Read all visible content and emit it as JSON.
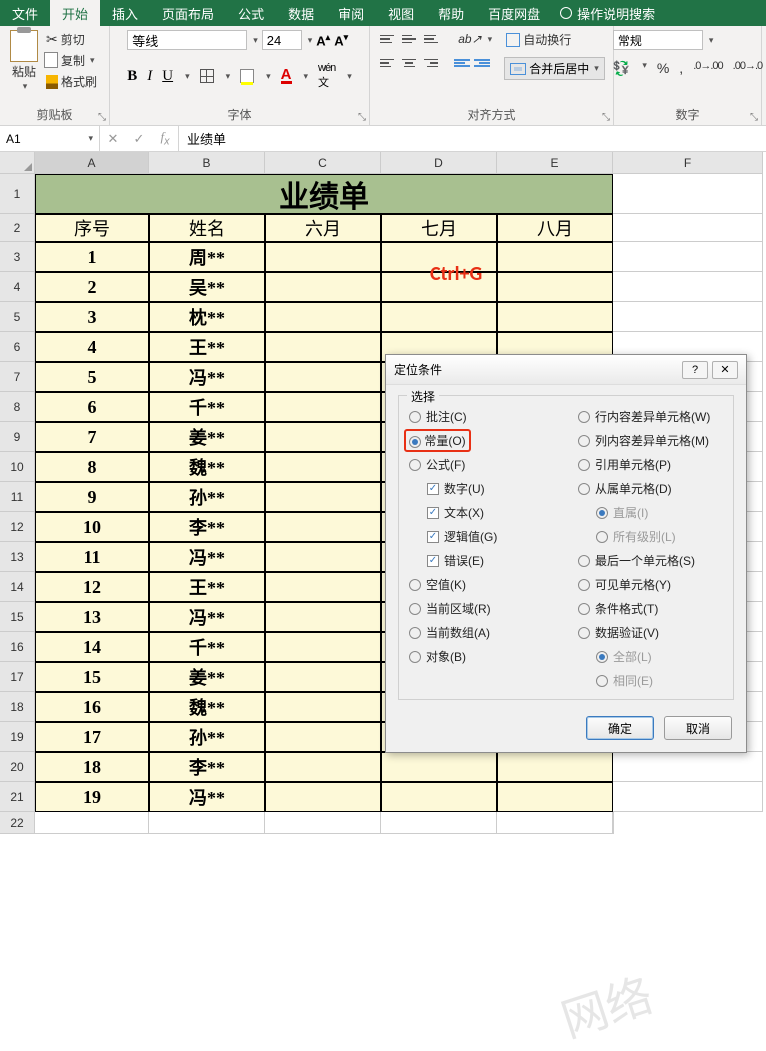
{
  "tabs": {
    "file": "文件",
    "home": "开始",
    "insert": "插入",
    "page_layout": "页面布局",
    "formulas": "公式",
    "data": "数据",
    "review": "审阅",
    "view": "视图",
    "help": "帮助",
    "baidu": "百度网盘",
    "tell_me": "操作说明搜索"
  },
  "ribbon": {
    "clipboard": {
      "label": "剪贴板",
      "paste": "粘贴",
      "cut": "剪切",
      "copy": "复制",
      "format_painter": "格式刷"
    },
    "font": {
      "label": "字体",
      "name": "等线",
      "size": "24"
    },
    "alignment": {
      "label": "对齐方式",
      "wrap": "自动换行",
      "merge": "合并后居中"
    },
    "number": {
      "label": "数字",
      "format": "常规"
    }
  },
  "formula_bar": {
    "name_box": "A1",
    "value": "业绩单"
  },
  "columns": [
    "A",
    "B",
    "C",
    "D",
    "E",
    "F"
  ],
  "sheet": {
    "title": "业绩单",
    "headers": [
      "序号",
      "姓名",
      "六月",
      "七月",
      "八月"
    ],
    "rows": [
      {
        "n": "1",
        "name": "周**"
      },
      {
        "n": "2",
        "name": "吴**"
      },
      {
        "n": "3",
        "name": "枕**"
      },
      {
        "n": "4",
        "name": "王**"
      },
      {
        "n": "5",
        "name": "冯**"
      },
      {
        "n": "6",
        "name": "千**"
      },
      {
        "n": "7",
        "name": "姜**"
      },
      {
        "n": "8",
        "name": "魏**"
      },
      {
        "n": "9",
        "name": "孙**"
      },
      {
        "n": "10",
        "name": "李**"
      },
      {
        "n": "11",
        "name": "冯**"
      },
      {
        "n": "12",
        "name": "王**"
      },
      {
        "n": "13",
        "name": "冯**"
      },
      {
        "n": "14",
        "name": "千**"
      },
      {
        "n": "15",
        "name": "姜**"
      },
      {
        "n": "16",
        "name": "魏**"
      },
      {
        "n": "17",
        "name": "孙**"
      },
      {
        "n": "18",
        "name": "李**"
      },
      {
        "n": "19",
        "name": "冯**"
      }
    ]
  },
  "hint": "Ctrl+G",
  "dialog": {
    "title": "定位条件",
    "section": "选择",
    "left": {
      "comments": "批注(C)",
      "constants": "常量(O)",
      "formulas": "公式(F)",
      "numbers": "数字(U)",
      "text": "文本(X)",
      "logicals": "逻辑值(G)",
      "errors": "错误(E)",
      "blanks": "空值(K)",
      "current_region": "当前区域(R)",
      "current_array": "当前数组(A)",
      "objects": "对象(B)"
    },
    "right": {
      "row_diff": "行内容差异单元格(W)",
      "col_diff": "列内容差异单元格(M)",
      "precedents": "引用单元格(P)",
      "dependents": "从属单元格(D)",
      "direct": "直属(I)",
      "all_levels": "所有级别(L)",
      "last_cell": "最后一个单元格(S)",
      "visible": "可见单元格(Y)",
      "cond_fmt": "条件格式(T)",
      "data_val": "数据验证(V)",
      "all": "全部(L)",
      "same": "相同(E)"
    },
    "ok": "确定",
    "cancel": "取消"
  },
  "watermark": "网络"
}
